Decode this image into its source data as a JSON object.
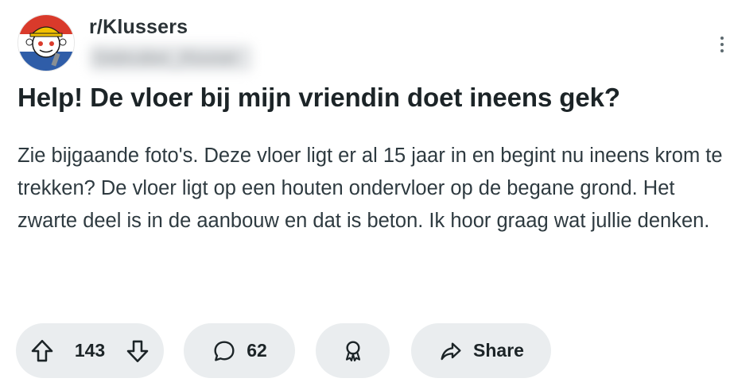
{
  "post": {
    "subreddit": "r/Klussers",
    "author": "Gebruiker_Klusser",
    "title": "Help! De vloer bij mijn vriendin doet ineens gek?",
    "body": "Zie bijgaande foto's. Deze vloer ligt er al 15 jaar in en begint nu ineens krom te trekken? De vloer ligt op een houten ondervloer op de begane grond. Het zwarte deel is in de aanbouw en dat is beton. Ik hoor graag wat jullie denken."
  },
  "actions": {
    "vote_count": "143",
    "comment_count": "62",
    "share_label": "Share"
  },
  "icons": {
    "upvote": "arrow-up-icon",
    "downvote": "arrow-down-icon",
    "comment": "comment-bubble-icon",
    "award": "award-icon",
    "share": "share-arrow-icon",
    "more": "more-options-icon"
  },
  "colors": {
    "pill_background": "#eaedef",
    "text_primary": "#1c2427",
    "avatar_red": "#d93a2b",
    "avatar_blue": "#2f5da8"
  }
}
